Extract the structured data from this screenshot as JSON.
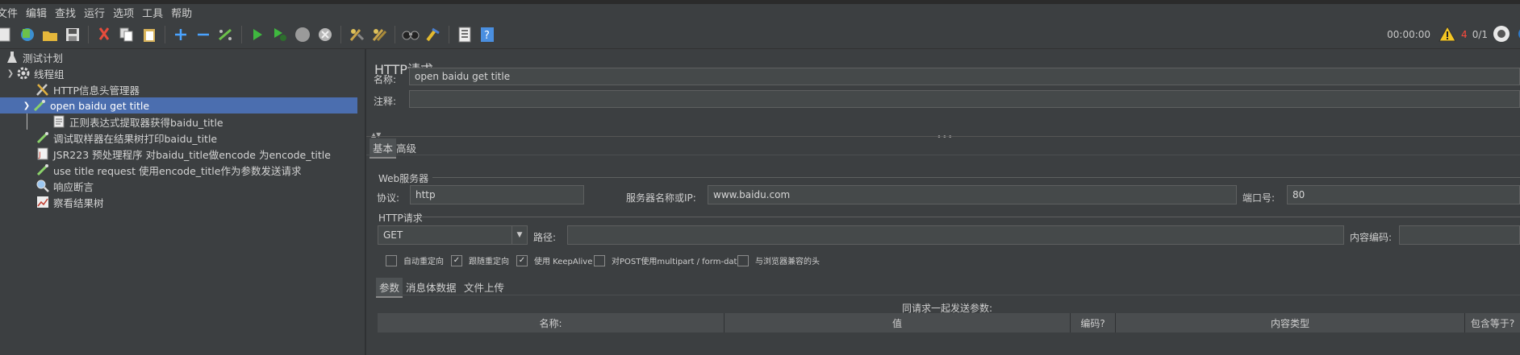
{
  "menu": [
    "文件",
    "编辑",
    "查找",
    "运行",
    "选项",
    "工具",
    "帮助"
  ],
  "toolbar": {
    "icons": [
      "new-icon",
      "templates-icon",
      "open-icon",
      "save-icon",
      "cut-icon",
      "copy-icon",
      "paste-icon",
      "expand-icon",
      "collapse-icon",
      "toggle-icon",
      "start-icon",
      "start-no-pause-icon",
      "stop-icon",
      "shutdown-icon",
      "clear-icon",
      "clear-all-icon",
      "search-icon",
      "reset-search-icon",
      "function-helper-icon",
      "help-icon"
    ],
    "timer": "00:00:00",
    "warnings": "4",
    "threads": "0/1"
  },
  "tree": [
    {
      "label": "测试计划",
      "icon": "flask-icon",
      "level": 0
    },
    {
      "label": "线程组",
      "icon": "gear-icon",
      "level": 1,
      "expanded": true
    },
    {
      "label": "HTTP信息头管理器",
      "icon": "wrench-icon",
      "level": 2
    },
    {
      "label": "open baidu get title",
      "icon": "pipette-icon",
      "level": 2,
      "expanded": true,
      "selected": true
    },
    {
      "label": "正则表达式提取器获得baidu_title",
      "icon": "document-icon",
      "level": 3
    },
    {
      "label": "调试取样器在结果树打印baidu_title",
      "icon": "pipette-icon",
      "level": 2
    },
    {
      "label": "JSR223 预处理程序  对baidu_title做encode 为encode_title",
      "icon": "script-icon",
      "level": 2
    },
    {
      "label": "use title request  使用encode_title作为参数发送请求",
      "icon": "pipette-icon",
      "level": 2
    },
    {
      "label": "响应断言",
      "icon": "magnifier-icon",
      "level": 2
    },
    {
      "label": "察看结果树",
      "icon": "chart-icon",
      "level": 2
    }
  ],
  "panel": {
    "title": "HTTP请求",
    "name_label": "名称:",
    "name_value": "open baidu get title",
    "comment_label": "注释:",
    "comment_value": "",
    "tabs": [
      "基本",
      "高级"
    ],
    "web_server": {
      "group_title": "Web服务器",
      "protocol_label": "协议:",
      "protocol_value": "http",
      "server_label": "服务器名称或IP:",
      "server_value": "www.baidu.com",
      "port_label": "端口号:",
      "port_value": "80"
    },
    "http_request": {
      "group_title": "HTTP请求",
      "method": "GET",
      "path_label": "路径:",
      "path_value": "",
      "encoding_label": "内容编码:",
      "encoding_value": ""
    },
    "options": [
      {
        "label": "自动重定向",
        "checked": false
      },
      {
        "label": "跟随重定向",
        "checked": true
      },
      {
        "label": "使用 KeepAlive",
        "checked": true
      },
      {
        "label": "对POST使用multipart / form-data",
        "checked": false
      },
      {
        "label": "与浏览器兼容的头",
        "checked": false
      }
    ],
    "subtabs": [
      "参数",
      "消息体数据",
      "文件上传"
    ],
    "params_caption": "同请求一起发送参数:",
    "table_headers": [
      "名称:",
      "值",
      "编码?",
      "内容类型",
      "包含等于?"
    ]
  }
}
